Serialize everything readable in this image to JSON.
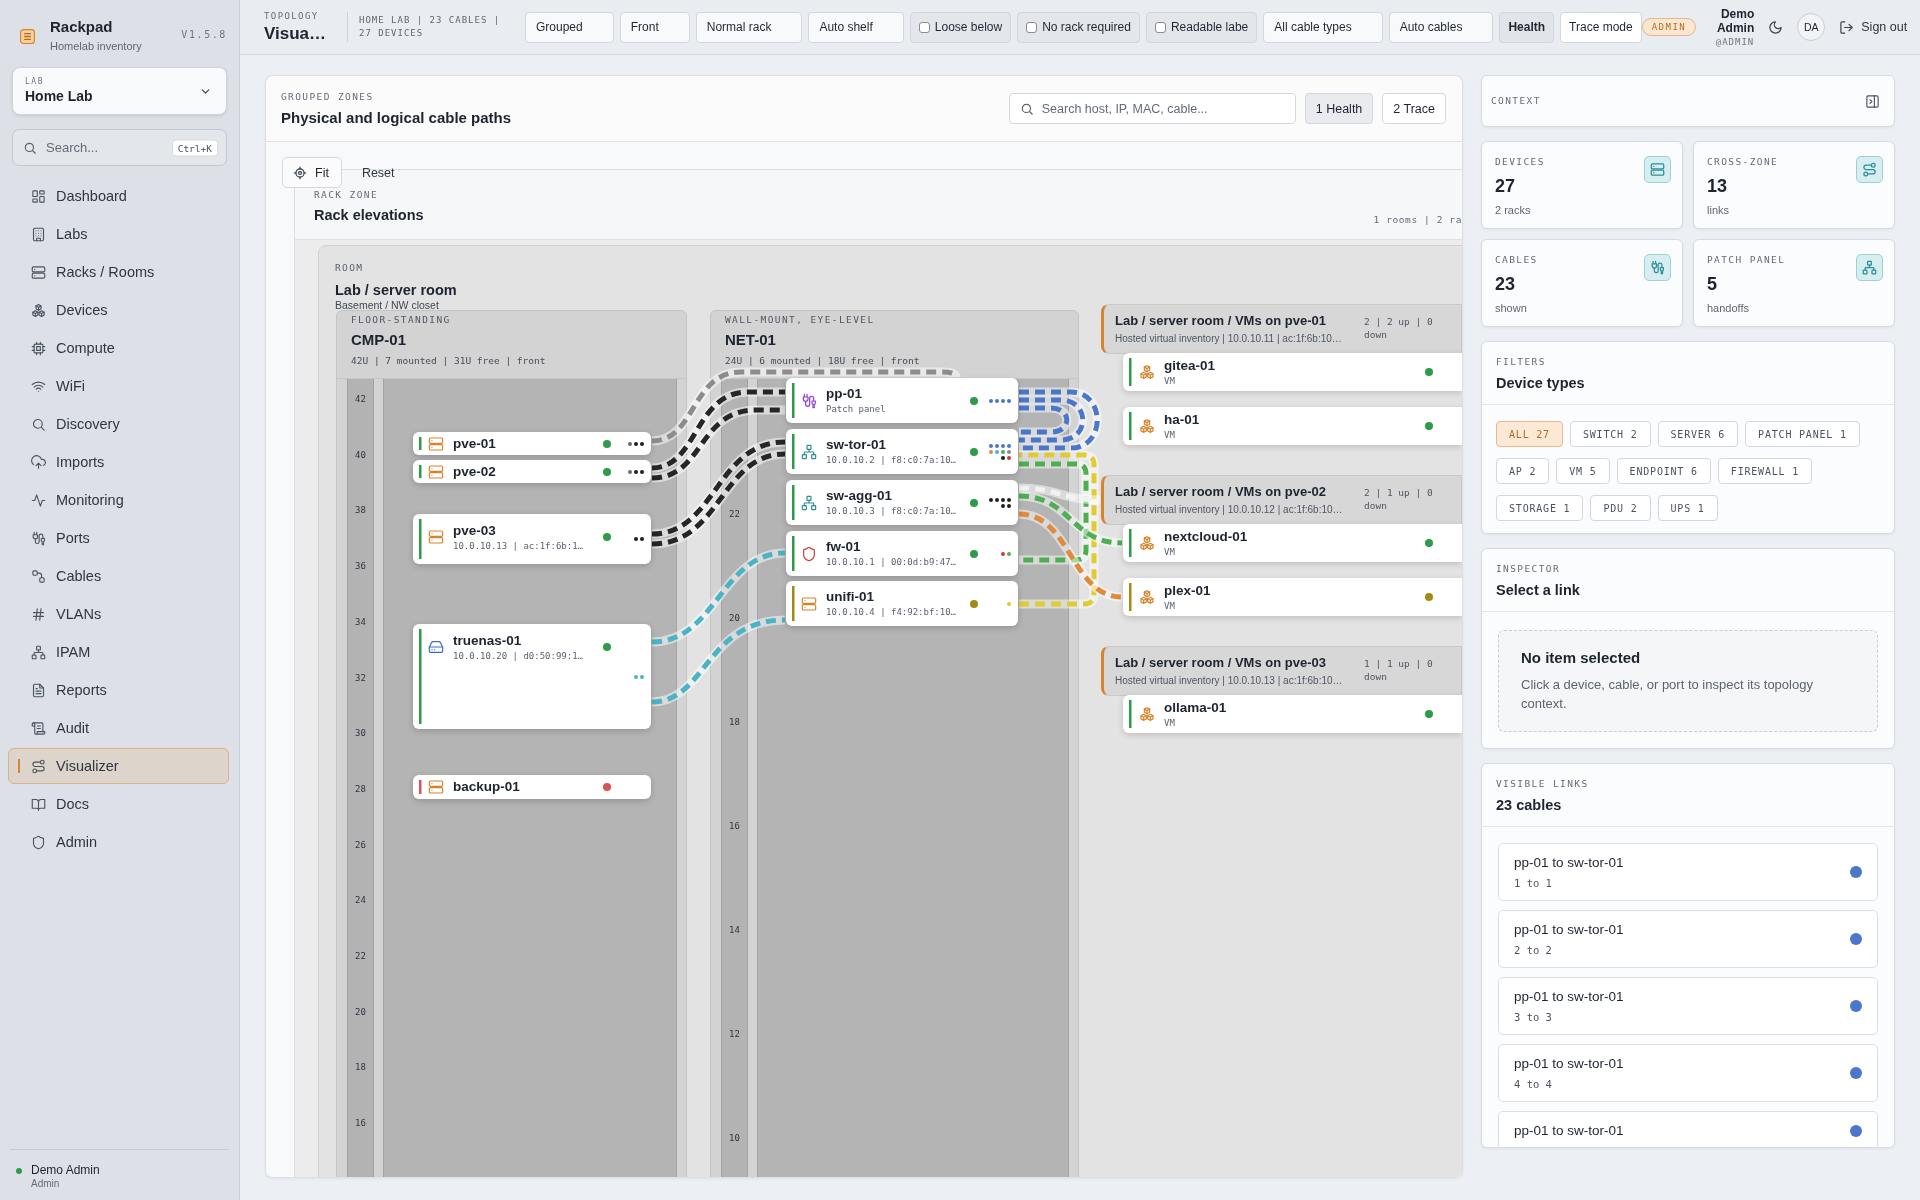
{
  "sidebar": {
    "brand": {
      "name": "Rackpad",
      "tagline": "Homelab inventory",
      "version": "V1.5.8"
    },
    "lab_selector": {
      "label": "LAB",
      "value": "Home Lab"
    },
    "search": {
      "placeholder": "Search...",
      "shortcut": "Ctrl+K"
    },
    "nav": [
      {
        "label": "Dashboard",
        "selected": false
      },
      {
        "label": "Labs",
        "selected": false
      },
      {
        "label": "Racks / Rooms",
        "selected": false
      },
      {
        "label": "Devices",
        "selected": false
      },
      {
        "label": "Compute",
        "selected": false
      },
      {
        "label": "WiFi",
        "selected": false
      },
      {
        "label": "Discovery",
        "selected": false
      },
      {
        "label": "Imports",
        "selected": false
      },
      {
        "label": "Monitoring",
        "selected": false
      },
      {
        "label": "Ports",
        "selected": false
      },
      {
        "label": "Cables",
        "selected": false
      },
      {
        "label": "VLANs",
        "selected": false
      },
      {
        "label": "IPAM",
        "selected": false
      },
      {
        "label": "Reports",
        "selected": false
      },
      {
        "label": "Audit",
        "selected": false
      },
      {
        "label": "Visualizer",
        "selected": true
      },
      {
        "label": "Docs",
        "selected": false
      },
      {
        "label": "Admin",
        "selected": false
      }
    ],
    "user": {
      "name": "Demo Admin",
      "role": "Admin",
      "online": true
    }
  },
  "topbar": {
    "section": "TOPOLOGY",
    "title": "Visua…",
    "summary": "HOME LAB | 23 CABLES | 27 DEVICES",
    "controls": [
      {
        "kind": "select",
        "label": "Grouped"
      },
      {
        "kind": "select",
        "label": "Front"
      },
      {
        "kind": "select",
        "label": "Normal rack"
      },
      {
        "kind": "select",
        "label": "Auto shelf"
      },
      {
        "kind": "checkbox",
        "label": "Loose below",
        "checked": false
      },
      {
        "kind": "checkbox",
        "label": "No rack required",
        "checked": false
      },
      {
        "kind": "checkbox",
        "label": "Readable labe",
        "checked": false
      },
      {
        "kind": "select",
        "label": "All cable types"
      },
      {
        "kind": "select",
        "label": "Auto cables"
      },
      {
        "kind": "toggle",
        "label": "Health",
        "on": true
      },
      {
        "kind": "toggle",
        "label": "Trace mode",
        "on": false
      }
    ],
    "role_badge": "ADMIN",
    "user": {
      "name": "Demo Admin",
      "handle": "@ADMIN",
      "initials": "DA"
    },
    "sign_out": "Sign out"
  },
  "canvas_panel": {
    "eyebrow": "GROUPED ZONES",
    "title": "Physical and logical cable paths",
    "search": {
      "placeholder": "Search host, IP, MAC, cable..."
    },
    "buttons": [
      {
        "label": "1 Health",
        "on": true
      },
      {
        "label": "2 Trace",
        "on": false
      }
    ],
    "fit": "Fit",
    "reset": "Reset",
    "zone": {
      "eyebrow": "RACK ZONE",
      "title": "Rack elevations",
      "summary": "1 rooms | 2 ra",
      "room": {
        "eyebrow": "ROOM",
        "title": "Lab / server room",
        "note": "Basement / NW closet",
        "racks": [
          {
            "label": "FLOOR-STANDING",
            "name": "CMP-01",
            "summary": "42U | 7 mounted | 31U free | front",
            "u_labels": [
              "42",
              "40",
              "38",
              "36",
              "34",
              "32",
              "30",
              "28",
              "26",
              "24",
              "22",
              "20",
              "18",
              "16"
            ],
            "devices": [
              {
                "name": "pve-01",
                "kind": "server",
                "color": "#2f9a4a",
                "ports": [
                  {
                    "color": "#6b6b6b"
                  },
                  {
                    "color": "#1f1f1f"
                  },
                  {
                    "color": "#1f1f1f"
                  }
                ]
              },
              {
                "name": "pve-02",
                "kind": "server",
                "color": "#2f9a4a",
                "ports": [
                  {
                    "color": "#6b6b6b"
                  },
                  {
                    "color": "#1f1f1f"
                  },
                  {
                    "color": "#1f1f1f"
                  }
                ]
              },
              {
                "name": "pve-03",
                "kind": "server",
                "sub": "10.0.10.13 | ac:1f:6b:1…",
                "color": "#2f9a4a",
                "ports": [
                  {
                    "color": "#1f1f1f"
                  },
                  {
                    "color": "#1f1f1f"
                  }
                ]
              },
              {
                "name": "truenas-01",
                "kind": "storage",
                "sub": "10.0.10.20 | d0:50:99:1…",
                "color": "#2f9a4a",
                "ports": [
                  {
                    "color": "#4bb3c6"
                  },
                  {
                    "color": "#4bb3c6"
                  }
                ]
              },
              {
                "name": "backup-01",
                "kind": "server",
                "color": "#d65454"
              }
            ]
          },
          {
            "label": "WALL-MOUNT, EYE-LEVEL",
            "name": "NET-01",
            "summary": "24U | 6 mounted | 18U free | front",
            "u_labels": [
              "22",
              "20",
              "18",
              "16",
              "14",
              "12",
              "10"
            ],
            "devices": [
              {
                "name": "pp-01",
                "kind": "patch_panel",
                "sub": "Patch panel",
                "color": "#2f9a4a",
                "ports": [
                  {
                    "color": "#4a77c9"
                  },
                  {
                    "color": "#4a77c9"
                  },
                  {
                    "color": "#4a77c9"
                  },
                  {
                    "color": "#4a77c9"
                  }
                ]
              },
              {
                "name": "sw-tor-01",
                "kind": "switch",
                "sub": "10.0.10.2 | f8:c0:7a:10…",
                "color": "#2f9a4a",
                "ports": [
                  {
                    "color": "#4a77c9"
                  },
                  {
                    "color": "#4a77c9"
                  },
                  {
                    "color": "#4a77c9"
                  },
                  {
                    "color": "#4a77c9"
                  },
                  {
                    "color": "#e08a3c"
                  },
                  {
                    "color": "#4bb3c6"
                  },
                  {
                    "color": "#4caf50"
                  },
                  {
                    "color": "#8c8c8c"
                  },
                  {
                    "color": "#1f1f1f"
                  },
                  {
                    "color": "#d03a3a"
                  }
                ]
              },
              {
                "name": "sw-agg-01",
                "kind": "switch",
                "sub": "10.0.10.3 | f8:c0:7a:10…",
                "color": "#2f9a4a",
                "ports": [
                  {
                    "color": "#1f1f1f"
                  },
                  {
                    "color": "#1f1f1f"
                  },
                  {
                    "color": "#1f1f1f"
                  },
                  {
                    "color": "#1f1f1f"
                  },
                  {
                    "color": "#1f1f1f"
                  },
                  {
                    "color": "#1f1f1f"
                  }
                ]
              },
              {
                "name": "fw-01",
                "kind": "firewall",
                "sub": "10.0.10.1 | 00:0d:b9:47…",
                "color": "#2f9a4a",
                "ports": [
                  {
                    "color": "#d03a3a"
                  },
                  {
                    "color": "#4caf50"
                  }
                ]
              },
              {
                "name": "unifi-01",
                "kind": "server",
                "sub": "10.0.10.4 | f4:92:bf:10…",
                "color": "#a38a12",
                "ports": [
                  {
                    "color": "#e0cb35"
                  }
                ]
              }
            ]
          }
        ],
        "vm_groups": [
          {
            "title": "Lab / server room / VMs on pve-01",
            "sub": "Hosted virtual inventory | 10.0.10.11 | ac:1f:6b:10…",
            "counts": "2 | 2 up | 0 down",
            "vms": [
              {
                "name": "gitea-01",
                "kind": "vm",
                "sub": "VM",
                "color": "#2f9a4a"
              },
              {
                "name": "ha-01",
                "kind": "vm",
                "sub": "VM",
                "color": "#2f9a4a"
              }
            ]
          },
          {
            "title": "Lab / server room / VMs on pve-02",
            "sub": "Hosted virtual inventory | 10.0.10.12 | ac:1f:6b:10…",
            "counts": "2 | 1 up | 0 down",
            "vms": [
              {
                "name": "nextcloud-01",
                "kind": "vm",
                "sub": "VM",
                "color": "#2f9a4a"
              },
              {
                "name": "plex-01",
                "kind": "vm",
                "sub": "VM",
                "color": "#a38a12"
              }
            ]
          },
          {
            "title": "Lab / server room / VMs on pve-03",
            "sub": "Hosted virtual inventory | 10.0.10.13 | ac:1f:6b:10…",
            "counts": "1 | 1 up | 0 down",
            "vms": [
              {
                "name": "ollama-01",
                "kind": "vm",
                "sub": "VM",
                "color": "#2f9a4a"
              }
            ]
          }
        ]
      }
    }
  },
  "context_panel": {
    "title": "CONTEXT",
    "stats": [
      {
        "label": "DEVICES",
        "value": "27",
        "sub": "2 racks"
      },
      {
        "label": "CROSS-ZONE",
        "value": "13",
        "sub": "links"
      },
      {
        "label": "CABLES",
        "value": "23",
        "sub": "shown"
      },
      {
        "label": "PATCH PANEL",
        "value": "5",
        "sub": "handoffs"
      }
    ],
    "filters": {
      "eyebrow": "FILTERS",
      "title": "Device types",
      "chips": [
        {
          "label": "ALL 27",
          "selected": true
        },
        {
          "label": "SWITCH 2",
          "selected": false
        },
        {
          "label": "SERVER 6",
          "selected": false
        },
        {
          "label": "PATCH PANEL 1",
          "selected": false
        },
        {
          "label": "AP 2",
          "selected": false
        },
        {
          "label": "VM 5",
          "selected": false
        },
        {
          "label": "ENDPOINT 6",
          "selected": false
        },
        {
          "label": "FIREWALL 1",
          "selected": false
        },
        {
          "label": "STORAGE 1",
          "selected": false
        },
        {
          "label": "PDU 2",
          "selected": false
        },
        {
          "label": "UPS 1",
          "selected": false
        }
      ]
    },
    "inspector": {
      "eyebrow": "INSPECTOR",
      "title": "Select a link",
      "empty_title": "No item selected",
      "empty_text": "Click a device, cable, or port to inspect its topology context."
    },
    "links": {
      "eyebrow": "VISIBLE LINKS",
      "title": "23 cables",
      "items": [
        {
          "title": "pp-01 to sw-tor-01",
          "sub": "1 to 1",
          "color": "#4a77c9"
        },
        {
          "title": "pp-01 to sw-tor-01",
          "sub": "2 to 2",
          "color": "#4a77c9"
        },
        {
          "title": "pp-01 to sw-tor-01",
          "sub": "3 to 3",
          "color": "#4a77c9"
        },
        {
          "title": "pp-01 to sw-tor-01",
          "sub": "4 to 4",
          "color": "#4a77c9"
        },
        {
          "title": "pp-01 to sw-tor-01",
          "color": "#4a77c9"
        }
      ]
    }
  }
}
